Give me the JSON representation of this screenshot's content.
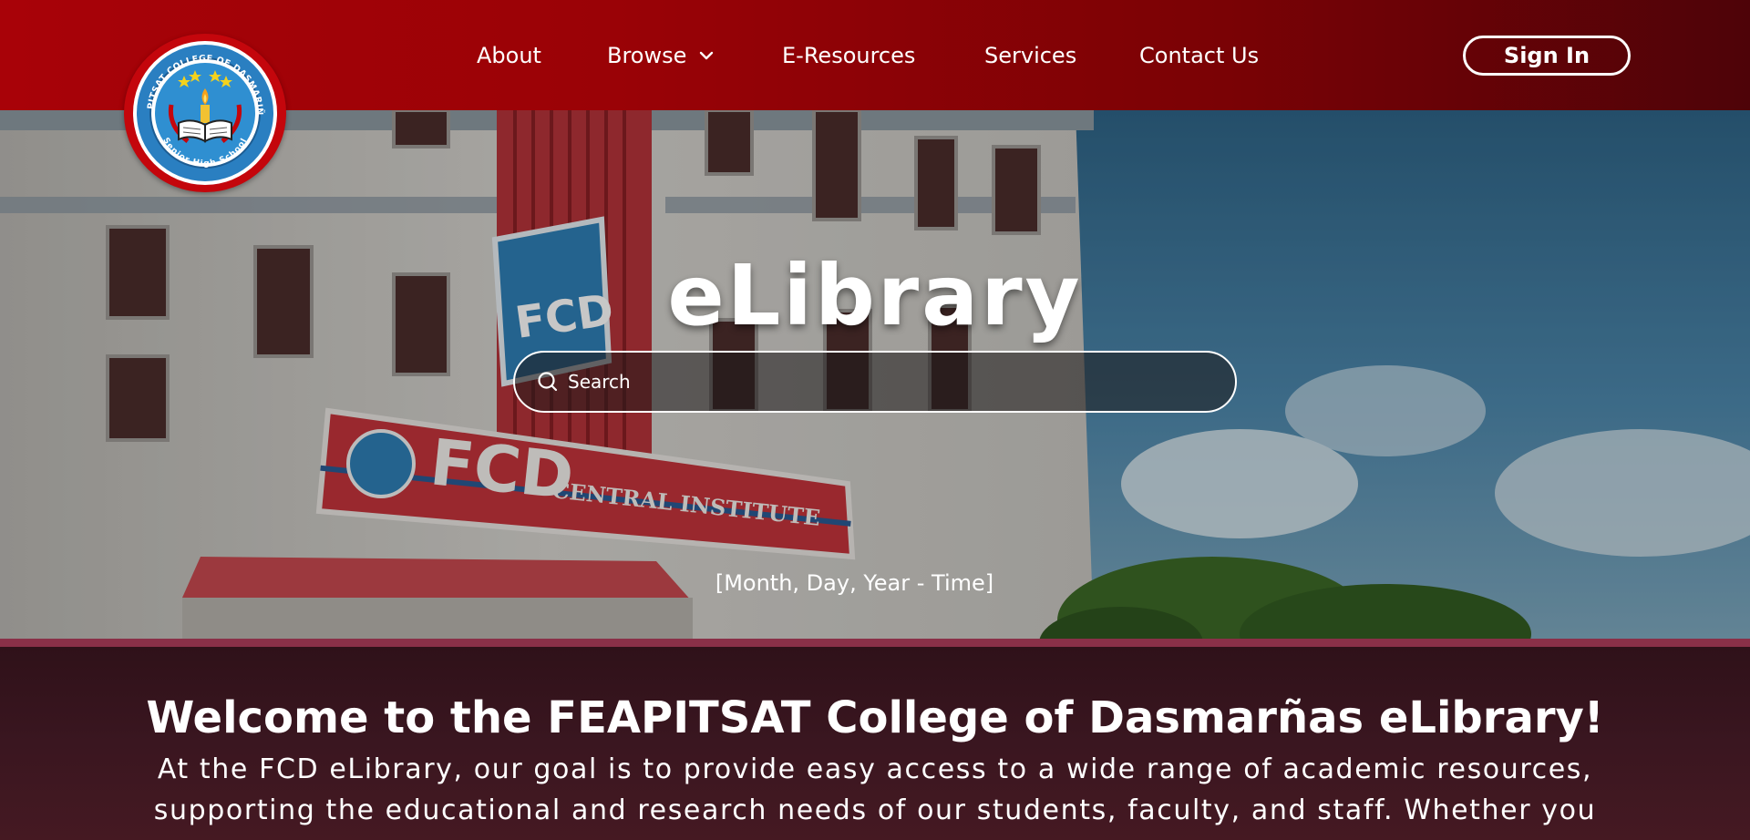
{
  "navbar": {
    "logo_text_top": "FEAPITSAT COLLEGE OF DASMARIÑAS",
    "logo_text_bottom": "Senior High School",
    "links": [
      {
        "label": "About"
      },
      {
        "label": "Browse"
      },
      {
        "label": "E-Resources"
      },
      {
        "label": "Services"
      },
      {
        "label": "Contact Us"
      }
    ],
    "sign_in_label": "Sign In"
  },
  "hero": {
    "title": "eLibrary",
    "search_placeholder": "Search",
    "datetime": "[Month, Day, Year - Time]",
    "building_sign_1": "FCD",
    "building_sign_2": "CENTRAL INSTITUTE"
  },
  "welcome": {
    "title": "Welcome to the FEAPITSAT College of Dasmarñas eLibrary!",
    "body": "At the FCD eLibrary, our goal is to provide easy access to a wide range of academic resources, supporting the educational and research needs of our students, faculty, and staff. Whether you are"
  },
  "colors": {
    "nav_red": "#a80208",
    "nav_dark": "#4e0308",
    "welcome_bg": "#3a1620",
    "divider": "#8a3048"
  }
}
